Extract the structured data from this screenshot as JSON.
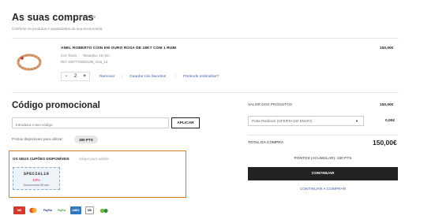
{
  "cart": {
    "title": "As suas compras",
    "count": "1 Produtos",
    "subtitle": "Confirme os produtos e quantidades da sua encomenda"
  },
  "product": {
    "name": "ANEL ROBERTO COIN EM OURO ROSA DE 18KT COM 1 RUBI",
    "price": "150,00€",
    "color_label": "Cor: Rosa",
    "size_label": "Tamanho: 15 mm",
    "ref": "Ref: 8497774825139_rosa_13",
    "quantity": "2",
    "minus": "-",
    "plus": "+",
    "remove": "Remover",
    "save_favorites": "Guardar nos favoritos",
    "gift_wrap": "Pretende embrulhar?"
  },
  "promo": {
    "title": "Código promocional",
    "input_placeholder": "Introduza o seu código",
    "apply_label": "APLICAR",
    "points_label": "Pontos disponíveis para utilizar:",
    "points_value": "300 PTS"
  },
  "coupons": {
    "title": "OS SEUS CUPÕES DISPONÍVEIS",
    "hint": "Clique para utilizar",
    "items": [
      {
        "code": "SPECIAL10",
        "discount": "10%",
        "min": "Encomenda 0€ min"
      }
    ]
  },
  "summary": {
    "products_label": "VALOR DOS PRODUTOS",
    "products_value": "150,00€",
    "shipping_option": "Porta Redicom (OFERTA DO ENVIO)",
    "shipping_value": "0,00€",
    "total_label": "TOTAL DA COMPRA",
    "total_value": "150,00€",
    "points_accumulated": "PONTOS (ACUMULAR): 150 PTS",
    "continue_label": "CONTINUAR",
    "continue_shopping": "CONTINUAR A COMPRAR"
  },
  "payment_methods": [
    {
      "icon": "multibanco-icon",
      "label": "MB"
    },
    {
      "icon": "mastercard-icon",
      "label": ""
    },
    {
      "icon": "paypal-icon",
      "label": "PayPal"
    },
    {
      "icon": "paypal-small-icon",
      "label": "PayPal"
    },
    {
      "icon": "amex-icon",
      "label": "AMEX"
    },
    {
      "icon": "mbway-icon",
      "label": "MB"
    },
    {
      "icon": "cofidis-icon",
      "label": ""
    }
  ],
  "colors": {
    "accent_orange": "#e07a22",
    "link_blue": "#3a5ba8",
    "button_dark": "#222222",
    "coupon_red": "#cc2233"
  }
}
